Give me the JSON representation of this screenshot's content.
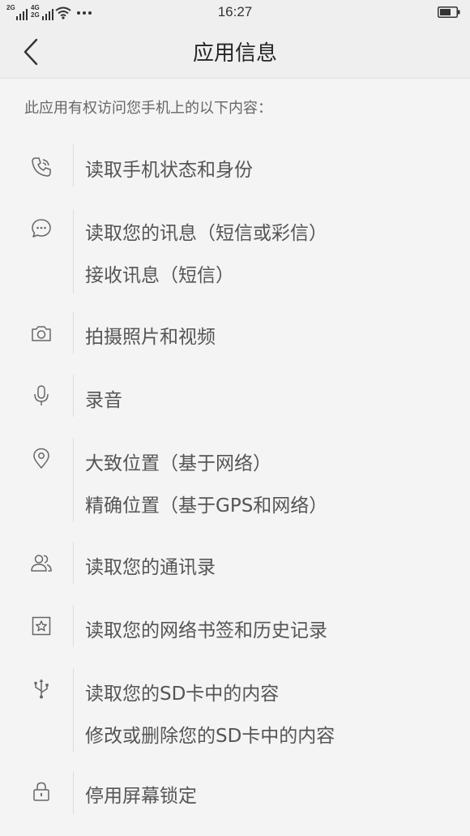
{
  "status_bar": {
    "network_1": "2G",
    "network_2_top": "4G",
    "network_2_bottom": "2G",
    "time": "16:27"
  },
  "header": {
    "title": "应用信息",
    "back_icon": "chevron-left-icon"
  },
  "intro": "此应用有权访问您手机上的以下内容：",
  "permissions": [
    {
      "icon": "phone-icon",
      "lines": [
        "读取手机状态和身份"
      ]
    },
    {
      "icon": "message-icon",
      "lines": [
        "读取您的讯息（短信或彩信）",
        "接收讯息（短信）"
      ]
    },
    {
      "icon": "camera-icon",
      "lines": [
        "拍摄照片和视频"
      ]
    },
    {
      "icon": "microphone-icon",
      "lines": [
        "录音"
      ]
    },
    {
      "icon": "location-pin-icon",
      "lines": [
        "大致位置（基于网络）",
        "精确位置（基于GPS和网络）"
      ]
    },
    {
      "icon": "contacts-icon",
      "lines": [
        "读取您的通讯录"
      ]
    },
    {
      "icon": "bookmark-star-icon",
      "lines": [
        "读取您的网络书签和历史记录"
      ]
    },
    {
      "icon": "usb-icon",
      "lines": [
        "读取您的SD卡中的内容",
        "修改或删除您的SD卡中的内容"
      ]
    },
    {
      "icon": "lock-icon",
      "lines": [
        "停用屏幕锁定"
      ]
    }
  ]
}
